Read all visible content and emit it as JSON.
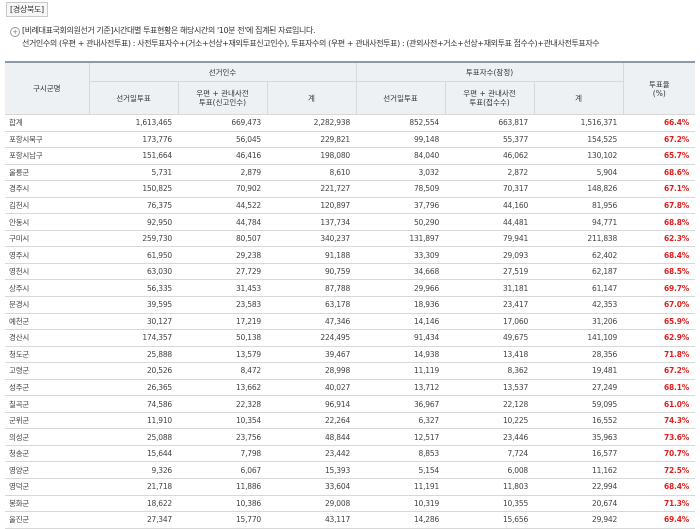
{
  "region_label": "[경상북도]",
  "note_line1": "[비례대표국회의원선거 기준]시간대별 투표현황은 해당시간의 '10분 전'에 집계된 자료입니다.",
  "note_line2": "선거인수의 (우편 + 관내사전투표) : 사전투표자수+(거소+선상+재외투표신고인수), 투표자수의 (우편 + 관내사전투표) : (관외사전+거소+선상+재외투표 접수수)+관내사전투표자수",
  "note_icon": "plus-circle-icon",
  "headers": {
    "district": "구시군명",
    "electors_group": "선거인수",
    "voters_group": "투표자수(잠정)",
    "rate": "투표율\n(%)",
    "electors_day": "선거일투표",
    "electors_mail": "우편 + 관내사전\n투표(신고인수)",
    "electors_total": "계",
    "voters_day": "선거일투표",
    "voters_mail": "우편 + 관내사전\n투표(접수수)",
    "voters_total": "계"
  },
  "rows": [
    {
      "name": "합계",
      "e_day": "1,613,465",
      "e_mail": "669,473",
      "e_total": "2,282,938",
      "v_day": "852,554",
      "v_mail": "663,817",
      "v_total": "1,516,371",
      "rate": "66.4%"
    },
    {
      "name": "포항시북구",
      "e_day": "173,776",
      "e_mail": "56,045",
      "e_total": "229,821",
      "v_day": "99,148",
      "v_mail": "55,377",
      "v_total": "154,525",
      "rate": "67.2%"
    },
    {
      "name": "포항시남구",
      "e_day": "151,664",
      "e_mail": "46,416",
      "e_total": "198,080",
      "v_day": "84,040",
      "v_mail": "46,062",
      "v_total": "130,102",
      "rate": "65.7%"
    },
    {
      "name": "울릉군",
      "e_day": "5,731",
      "e_mail": "2,879",
      "e_total": "8,610",
      "v_day": "3,032",
      "v_mail": "2,872",
      "v_total": "5,904",
      "rate": "68.6%"
    },
    {
      "name": "경주시",
      "e_day": "150,825",
      "e_mail": "70,902",
      "e_total": "221,727",
      "v_day": "78,509",
      "v_mail": "70,317",
      "v_total": "148,826",
      "rate": "67.1%"
    },
    {
      "name": "김천시",
      "e_day": "76,375",
      "e_mail": "44,522",
      "e_total": "120,897",
      "v_day": "37,796",
      "v_mail": "44,160",
      "v_total": "81,956",
      "rate": "67.8%"
    },
    {
      "name": "안동시",
      "e_day": "92,950",
      "e_mail": "44,784",
      "e_total": "137,734",
      "v_day": "50,290",
      "v_mail": "44,481",
      "v_total": "94,771",
      "rate": "68.8%"
    },
    {
      "name": "구미시",
      "e_day": "259,730",
      "e_mail": "80,507",
      "e_total": "340,237",
      "v_day": "131,897",
      "v_mail": "79,941",
      "v_total": "211,838",
      "rate": "62.3%"
    },
    {
      "name": "영주시",
      "e_day": "61,950",
      "e_mail": "29,238",
      "e_total": "91,188",
      "v_day": "33,309",
      "v_mail": "29,093",
      "v_total": "62,402",
      "rate": "68.4%"
    },
    {
      "name": "영천시",
      "e_day": "63,030",
      "e_mail": "27,729",
      "e_total": "90,759",
      "v_day": "34,668",
      "v_mail": "27,519",
      "v_total": "62,187",
      "rate": "68.5%"
    },
    {
      "name": "상주시",
      "e_day": "56,335",
      "e_mail": "31,453",
      "e_total": "87,788",
      "v_day": "29,966",
      "v_mail": "31,181",
      "v_total": "61,147",
      "rate": "69.7%"
    },
    {
      "name": "문경시",
      "e_day": "39,595",
      "e_mail": "23,583",
      "e_total": "63,178",
      "v_day": "18,936",
      "v_mail": "23,417",
      "v_total": "42,353",
      "rate": "67.0%"
    },
    {
      "name": "예천군",
      "e_day": "30,127",
      "e_mail": "17,219",
      "e_total": "47,346",
      "v_day": "14,146",
      "v_mail": "17,060",
      "v_total": "31,206",
      "rate": "65.9%"
    },
    {
      "name": "경산시",
      "e_day": "174,357",
      "e_mail": "50,138",
      "e_total": "224,495",
      "v_day": "91,434",
      "v_mail": "49,675",
      "v_total": "141,109",
      "rate": "62.9%"
    },
    {
      "name": "청도군",
      "e_day": "25,888",
      "e_mail": "13,579",
      "e_total": "39,467",
      "v_day": "14,938",
      "v_mail": "13,418",
      "v_total": "28,356",
      "rate": "71.8%"
    },
    {
      "name": "고령군",
      "e_day": "20,526",
      "e_mail": "8,472",
      "e_total": "28,998",
      "v_day": "11,119",
      "v_mail": "8,362",
      "v_total": "19,481",
      "rate": "67.2%"
    },
    {
      "name": "성주군",
      "e_day": "26,365",
      "e_mail": "13,662",
      "e_total": "40,027",
      "v_day": "13,712",
      "v_mail": "13,537",
      "v_total": "27,249",
      "rate": "68.1%"
    },
    {
      "name": "칠곡군",
      "e_day": "74,586",
      "e_mail": "22,328",
      "e_total": "96,914",
      "v_day": "36,967",
      "v_mail": "22,128",
      "v_total": "59,095",
      "rate": "61.0%"
    },
    {
      "name": "군위군",
      "e_day": "11,910",
      "e_mail": "10,354",
      "e_total": "22,264",
      "v_day": "6,327",
      "v_mail": "10,225",
      "v_total": "16,552",
      "rate": "74.3%"
    },
    {
      "name": "의성군",
      "e_day": "25,088",
      "e_mail": "23,756",
      "e_total": "48,844",
      "v_day": "12,517",
      "v_mail": "23,446",
      "v_total": "35,963",
      "rate": "73.6%"
    },
    {
      "name": "청송군",
      "e_day": "15,644",
      "e_mail": "7,798",
      "e_total": "23,442",
      "v_day": "8,853",
      "v_mail": "7,724",
      "v_total": "16,577",
      "rate": "70.7%"
    },
    {
      "name": "영양군",
      "e_day": "9,326",
      "e_mail": "6,067",
      "e_total": "15,393",
      "v_day": "5,154",
      "v_mail": "6,008",
      "v_total": "11,162",
      "rate": "72.5%"
    },
    {
      "name": "영덕군",
      "e_day": "21,718",
      "e_mail": "11,886",
      "e_total": "33,604",
      "v_day": "11,191",
      "v_mail": "11,803",
      "v_total": "22,994",
      "rate": "68.4%"
    },
    {
      "name": "봉화군",
      "e_day": "18,622",
      "e_mail": "10,386",
      "e_total": "29,008",
      "v_day": "10,319",
      "v_mail": "10,355",
      "v_total": "20,674",
      "rate": "71.3%"
    },
    {
      "name": "울진군",
      "e_day": "27,347",
      "e_mail": "15,770",
      "e_total": "43,117",
      "v_day": "14,286",
      "v_mail": "15,656",
      "v_total": "29,942",
      "rate": "69.4%"
    }
  ]
}
